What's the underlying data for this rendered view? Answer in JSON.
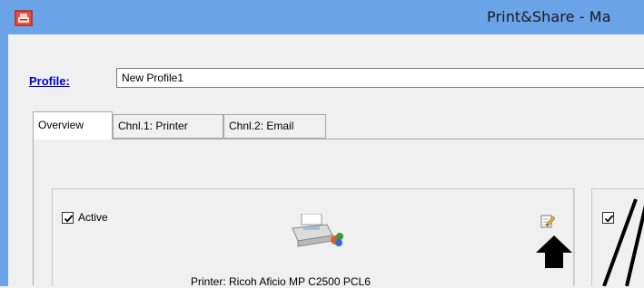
{
  "window": {
    "title": "Print&Share - Ma"
  },
  "profile": {
    "label": "Profile:",
    "value": "New Profile1"
  },
  "tabs": [
    {
      "label": "Overview",
      "active": true
    },
    {
      "label": "Chnl.1: Printer",
      "active": false
    },
    {
      "label": "Chnl.2: Email",
      "active": false
    }
  ],
  "channel_card": {
    "active_label": "Active",
    "active_checked": true,
    "printer_text": "Printer: Ricoh Aficio MP C2500 PCL6",
    "icon": "printer-icon",
    "edit_icon": "edit-icon"
  },
  "second_card": {
    "checked": true
  },
  "annotations": {
    "arrow_color": "#000000"
  },
  "colors": {
    "titlebar": "#6aa3e8",
    "link": "#0000cc"
  }
}
